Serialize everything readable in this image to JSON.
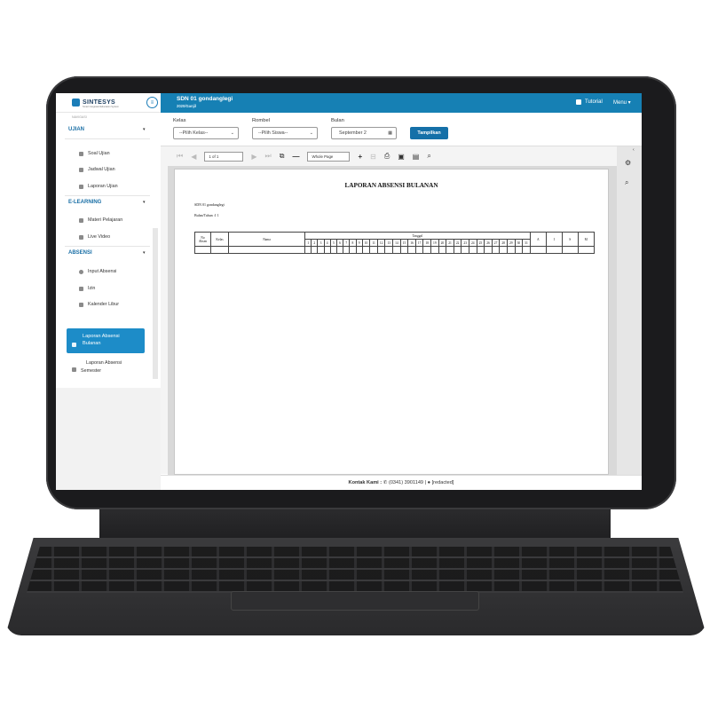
{
  "brand": {
    "name": "SINTESYS",
    "tagline": "Smart Integrated Education System"
  },
  "header": {
    "school": "SDN 01 gondanglegi",
    "term": "2020/Ganjil",
    "tutorial": "Tutorial",
    "menu": "Menu ▾"
  },
  "sidebar": {
    "nav_label": "NAVIGASI",
    "sections": [
      {
        "title": "UJIAN",
        "items": [
          "Soal Ujian",
          "Jadwal Ujian",
          "Laporan Ujian"
        ]
      },
      {
        "title": "E-LEARNING",
        "items": [
          "Materi Pelajaran",
          "Live Video"
        ]
      },
      {
        "title": "ABSENSI",
        "items": [
          "Input Absensi",
          "Izin",
          "Kalender Libur",
          "Laporan Absensi Bulanan",
          "Laporan Absensi Semester"
        ]
      }
    ],
    "active_line1": "Laporan Absensi",
    "active_line2": "Bulanan",
    "semester_line1": "Laporan Absensi",
    "semester_line2": "Semester"
  },
  "filters": {
    "kelas_label": "Kelas",
    "kelas_value": "--Pilih Kelas--",
    "rombel_label": "Rombel",
    "rombel_value": "--Pilih Siswa--",
    "bulan_label": "Bulan",
    "bulan_value": "September 2",
    "submit": "Tampilkan"
  },
  "viewer": {
    "page_value": "1 of 1",
    "zoom_value": "Whole Page"
  },
  "report": {
    "title": "LAPORAN ABSENSI BULANAN",
    "school_line": "SDN 01 gondanglegi",
    "month_line": "Bulan/Tahun :1 1",
    "col_no": "No",
    "col_absen": "Absen",
    "col_kelas": "Kelas",
    "col_nama": "Nama",
    "col_tanggal": "Tanggal",
    "days": [
      "1",
      "2",
      "3",
      "4",
      "5",
      "6",
      "7",
      "8",
      "9",
      "10",
      "11",
      "12",
      "13",
      "14",
      "15",
      "16",
      "17",
      "18",
      "19",
      "20",
      "21",
      "22",
      "23",
      "24",
      "25",
      "26",
      "27",
      "28",
      "29",
      "30",
      "31"
    ],
    "col_a": "A",
    "col_i": "I",
    "col_s": "S",
    "col_m": "M"
  },
  "footer": {
    "label": "Kontak Kami :",
    "phone": "(0341) 3901149"
  }
}
